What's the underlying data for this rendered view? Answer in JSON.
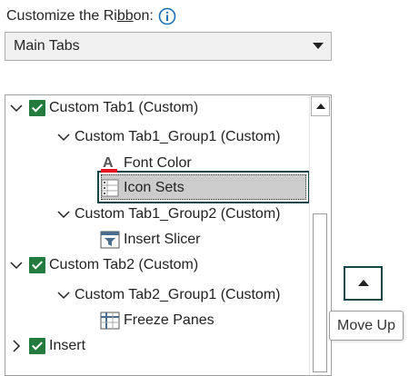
{
  "header": {
    "label_prefix": "Customize the Ri",
    "label_accel": "bb",
    "label_suffix": "on:",
    "info_icon": "info-icon"
  },
  "dropdown": {
    "selected": "Main Tabs"
  },
  "tree": {
    "items": [
      {
        "label": "Custom Tab1 (Custom)",
        "checked": true
      },
      {
        "label": "Custom Tab1_Group1 (Custom)"
      },
      {
        "label": "Font Color",
        "icon": "font-color-icon"
      },
      {
        "label": "Icon Sets",
        "icon": "icon-sets-icon",
        "selected": true
      },
      {
        "label": "Custom Tab1_Group2 (Custom)"
      },
      {
        "label": "Insert Slicer",
        "icon": "insert-slicer-icon"
      },
      {
        "label": "Custom Tab2 (Custom)",
        "checked": true
      },
      {
        "label": "Custom Tab2_Group1 (Custom)"
      },
      {
        "label": "Freeze Panes",
        "icon": "freeze-panes-icon"
      },
      {
        "label": "Insert",
        "checked": true
      }
    ]
  },
  "move_up": {
    "tooltip": "Move Up"
  },
  "colors": {
    "checkbox": "#237b3e",
    "focus_border": "#17464a",
    "selection_fill": "#cccccc",
    "info_blue": "#1a6fb5",
    "font_color_red": "#e81123"
  }
}
